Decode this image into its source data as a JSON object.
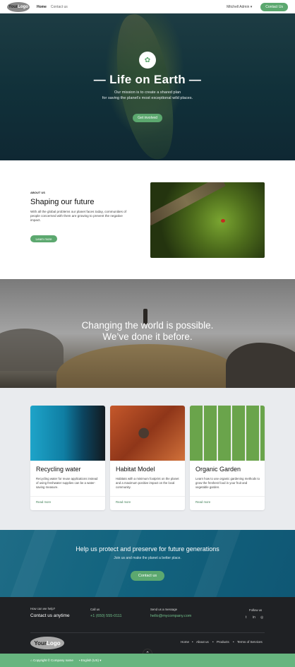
{
  "header": {
    "logo": {
      "part1": "Your",
      "part2": "Logo"
    },
    "nav": [
      "Home",
      "Contact us"
    ],
    "user": "Mitchell Admin",
    "contact_button": "Contact Us"
  },
  "hero": {
    "title": "— Life on Earth —",
    "subtitle_line1": "Our mission is to create a shared plan",
    "subtitle_line2": "for saving the planet's most exceptional wild places.",
    "button": "Get involved"
  },
  "about": {
    "kicker": "ABOUT US",
    "title": "Shaping our future",
    "text": "With all the global problems our planet faces today, communities of people concerned with them are growing to prevent the negative impact.",
    "button": "Learn more"
  },
  "banner": {
    "line1": "Changing the world is possible.",
    "line2": "We’ve done it before."
  },
  "cards": [
    {
      "title": "Recycling water",
      "text": "Recycling water for reuse applications instead of using freshwater supplies can be a water-saving measure.",
      "link": "Read more"
    },
    {
      "title": "Habitat Model",
      "text": "Habitats with a minimum footprint on the planet and a maximum positive impact on the local community.",
      "link": "Read more"
    },
    {
      "title": "Organic Garden",
      "text": "Learn how to use organic gardening methods to grow the freshest food in your fruit and vegetable garden.",
      "link": "Read more"
    }
  ],
  "cta": {
    "title": "Help us protect and preserve for future generations",
    "subtitle": "Join us and make the planet a better place.",
    "button": "Contact us"
  },
  "footer": {
    "help_label": "How can we help?",
    "help_value": "Contact us anytime",
    "call_label": "Call us",
    "call_value": "+1 (650) 555-0111",
    "msg_label": "Send us a message",
    "msg_value": "hello@mycompany.com",
    "follow_label": "Follow us",
    "social": [
      "twitter-icon",
      "linkedin-icon",
      "instagram-icon"
    ],
    "logo": {
      "part1": "Your",
      "part2": "Logo"
    },
    "links": [
      "Home",
      "About us",
      "Products",
      "Terms of Services"
    ],
    "copyright": "Copyright © Company name",
    "language": "English (US)"
  },
  "colors": {
    "accent": "#5ca86f",
    "footer": "#1f2124",
    "cta": "#13647f"
  }
}
